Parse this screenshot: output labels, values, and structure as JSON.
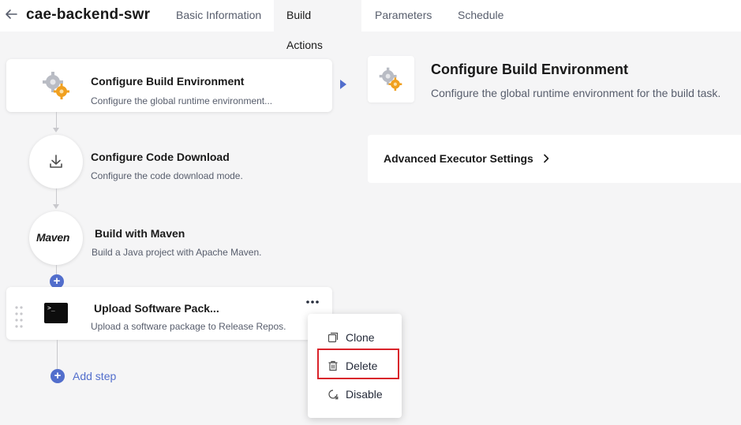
{
  "header": {
    "title": "cae-backend-swr",
    "tabs": [
      {
        "label": "Basic Information"
      },
      {
        "label": "Build Actions"
      },
      {
        "label": "Parameters"
      },
      {
        "label": "Schedule"
      }
    ]
  },
  "steps": [
    {
      "title": "Configure Build Environment",
      "desc": "Configure the global runtime environment..."
    },
    {
      "title": "Configure Code Download",
      "desc": "Configure the code download mode."
    },
    {
      "title": "Build with Maven",
      "desc": "Build a Java project with Apache Maven.",
      "logo_text": "Maven"
    },
    {
      "title": "Upload Software Pack...",
      "desc": "Upload a software package to Release Repos.",
      "terminal_prompt": ">_"
    }
  ],
  "add_step": {
    "label": "Add step"
  },
  "context_menu": {
    "items": [
      {
        "label": "Clone",
        "icon": "copy-icon"
      },
      {
        "label": "Delete",
        "icon": "trash-icon"
      },
      {
        "label": "Disable",
        "icon": "disable-icon"
      }
    ],
    "highlighted": "Delete"
  },
  "detail": {
    "title": "Configure Build Environment",
    "desc": "Configure the global runtime environment for the build task.",
    "advanced_label": "Advanced Executor Settings"
  },
  "colors": {
    "accent": "#526ecc",
    "highlight_border": "#d9232a",
    "gear_gray": "#b9bcc4",
    "gear_orange": "#f0a020"
  }
}
